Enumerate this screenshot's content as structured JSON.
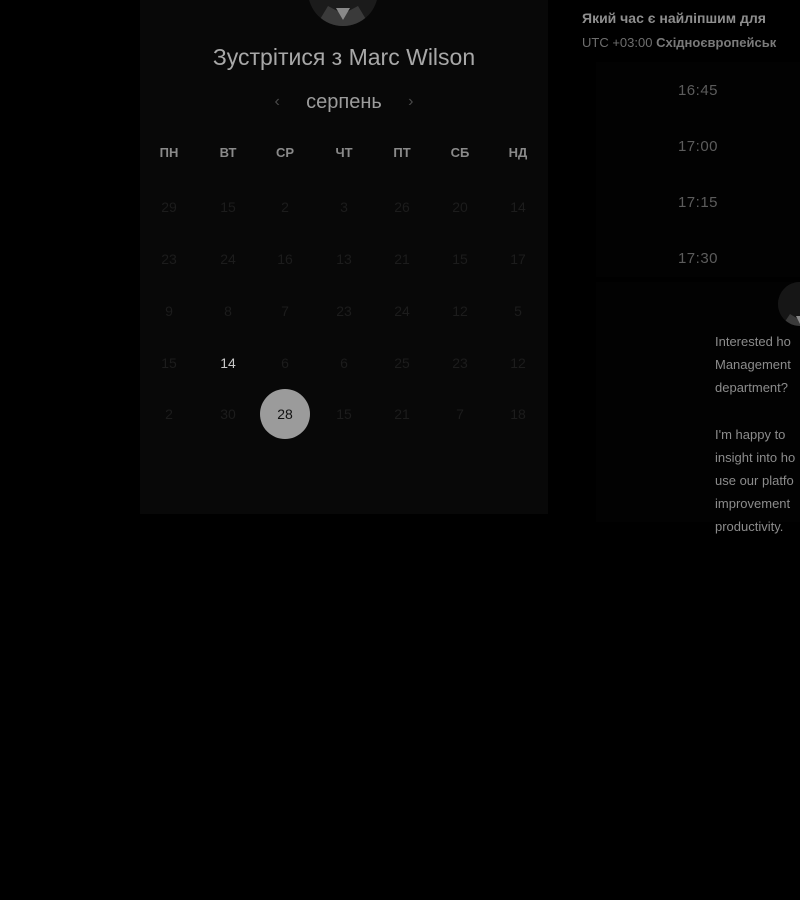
{
  "booking": {
    "title": "Зустрітися з Marc Wilson",
    "month": "серпень",
    "prev_icon": "chevron-left-icon",
    "next_icon": "chevron-right-icon",
    "weekdays": [
      "ПН",
      "ВТ",
      "СР",
      "ЧТ",
      "ПТ",
      "СБ",
      "НД"
    ],
    "weeks": [
      [
        "29",
        "15",
        "2",
        "3",
        "26",
        "20",
        "14"
      ],
      [
        "23",
        "24",
        "16",
        "13",
        "21",
        "15",
        "17"
      ],
      [
        "9",
        "8",
        "7",
        "23",
        "24",
        "12",
        "5"
      ],
      [
        "15",
        "14",
        "6",
        "6",
        "25",
        "23",
        "12"
      ],
      [
        "2",
        "30",
        "28",
        "15",
        "21",
        "7",
        "18"
      ]
    ],
    "available_day": "14",
    "selected_day": "28",
    "colors": {
      "selected_bg": "#9b9b9b",
      "panel_bg": "#080808"
    }
  },
  "sidebar": {
    "question": "Який час є найліпшим для",
    "timezone_offset": "UTC +03:00",
    "timezone_name": "Східноєвропейськ",
    "slots": [
      "16:45",
      "17:00",
      "17:15",
      "17:30"
    ],
    "message_lines_1": [
      "Interested ho",
      "Management",
      "department?"
    ],
    "message_lines_2": [
      "I'm happy to",
      "insight into ho",
      "use our platfo",
      "improvement",
      "productivity."
    ]
  }
}
